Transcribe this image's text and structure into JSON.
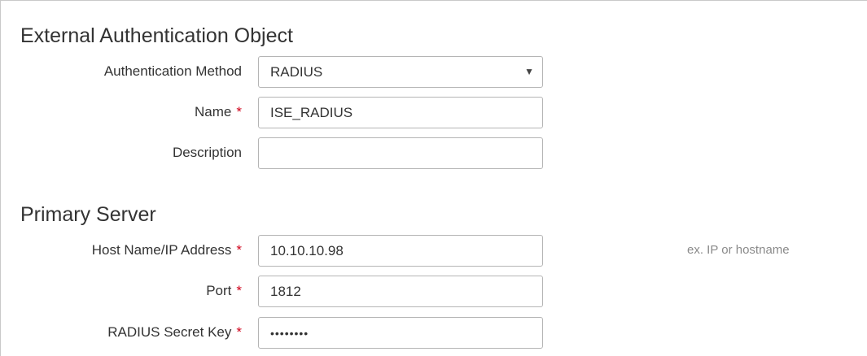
{
  "sections": {
    "external_auth_title": "External Authentication Object",
    "primary_server_title": "Primary Server"
  },
  "fields": {
    "auth_method": {
      "label": "Authentication Method",
      "value": "RADIUS"
    },
    "name": {
      "label": "Name",
      "value": "ISE_RADIUS",
      "required_mark": "*"
    },
    "description": {
      "label": "Description",
      "value": ""
    },
    "host": {
      "label": "Host Name/IP Address",
      "value": "10.10.10.98",
      "required_mark": "*",
      "hint": "ex. IP or hostname"
    },
    "port": {
      "label": "Port",
      "value": "1812",
      "required_mark": "*"
    },
    "secret": {
      "label": "RADIUS Secret Key",
      "value": "••••••••",
      "required_mark": "*"
    }
  },
  "icons": {
    "dropdown_arrow": "caret-down-icon"
  },
  "colors": {
    "required": "#d0021b",
    "hint": "#8a8a8a",
    "border": "#b5b5b5"
  }
}
